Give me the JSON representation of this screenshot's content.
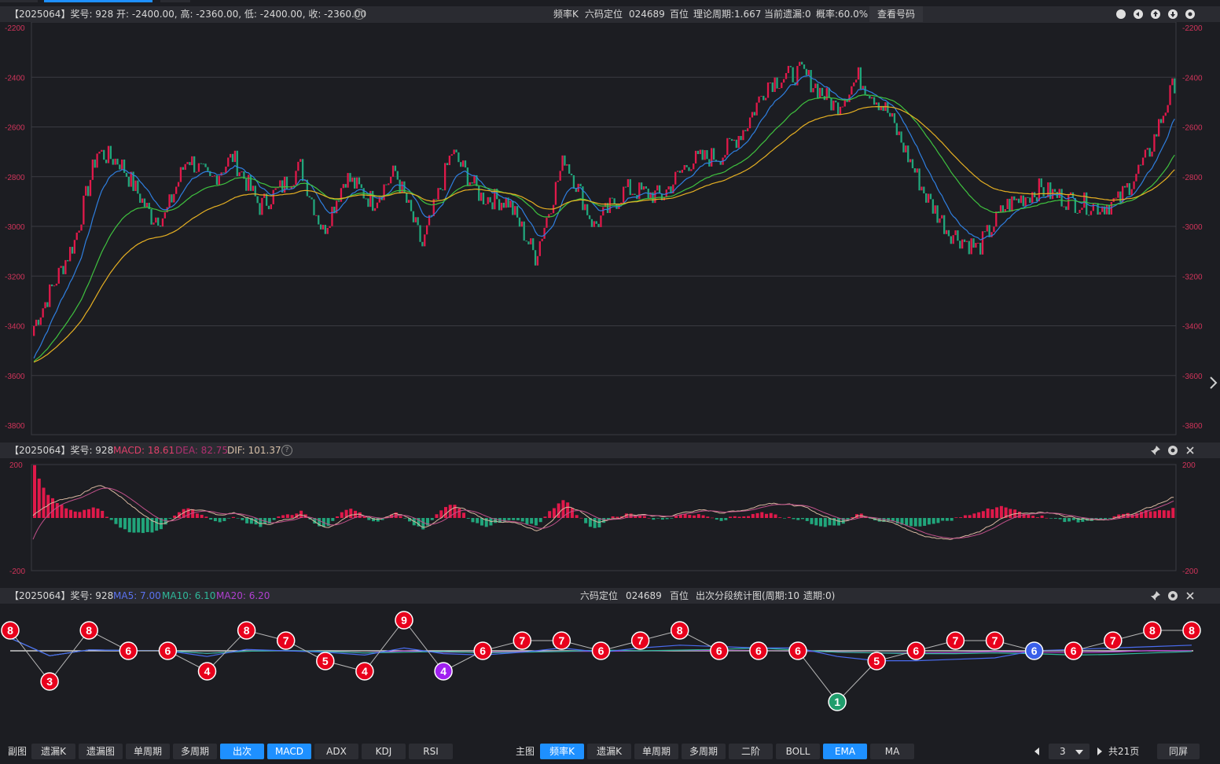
{
  "main_header": {
    "issue": "【2025064】奖号: 928",
    "ohlc": "开: -2400.00, 高: -2360.00, 低: -2400.00, 收: -2360.00",
    "mode": "频率K",
    "position_label": "六码定位",
    "codes": "024689",
    "digit": "百位",
    "theory_cycle": "理论周期:1.667",
    "current_miss": "当前遗漏:0",
    "probability": "概率:60.0%",
    "view_button": "查看号码"
  },
  "main_axis": {
    "ticks": [
      "-2200",
      "-2400",
      "-2600",
      "-2800",
      "-3000",
      "-3200",
      "-3400",
      "-3600",
      "-3800"
    ]
  },
  "macd_header": {
    "issue": "【2025064】奖号: 928",
    "macd_label": "MACD: 18.61",
    "dea_label": "DEA: 82.75",
    "dif_label": "DIF: 101.37"
  },
  "macd_axis": {
    "top": "200",
    "bottom": "-200"
  },
  "stat_header": {
    "issue": "【2025064】奖号: 928",
    "ma5_label": "MA5: 7.00",
    "ma10_label": "MA10: 6.10",
    "ma20_label": "MA20: 6.20",
    "position_label": "六码定位",
    "codes": "024689",
    "digit": "百位",
    "chart_title": "出次分段统计图(周期:10",
    "miss_note": "遗期:0)"
  },
  "stat_nodes": [
    {
      "v": "8",
      "c": "#e8001c"
    },
    {
      "v": "3",
      "c": "#e8001c"
    },
    {
      "v": "8",
      "c": "#e8001c"
    },
    {
      "v": "6",
      "c": "#e8001c"
    },
    {
      "v": "6",
      "c": "#e8001c"
    },
    {
      "v": "4",
      "c": "#e8001c"
    },
    {
      "v": "8",
      "c": "#e8001c"
    },
    {
      "v": "7",
      "c": "#e8001c"
    },
    {
      "v": "5",
      "c": "#e8001c"
    },
    {
      "v": "4",
      "c": "#e8001c"
    },
    {
      "v": "9",
      "c": "#e8001c"
    },
    {
      "v": "4",
      "c": "#a020f0"
    },
    {
      "v": "6",
      "c": "#e8001c"
    },
    {
      "v": "7",
      "c": "#e8001c"
    },
    {
      "v": "7",
      "c": "#e8001c"
    },
    {
      "v": "6",
      "c": "#e8001c"
    },
    {
      "v": "7",
      "c": "#e8001c"
    },
    {
      "v": "8",
      "c": "#e8001c"
    },
    {
      "v": "6",
      "c": "#e8001c"
    },
    {
      "v": "6",
      "c": "#e8001c"
    },
    {
      "v": "6",
      "c": "#e8001c"
    },
    {
      "v": "1",
      "c": "#1f9d6c"
    },
    {
      "v": "5",
      "c": "#e8001c"
    },
    {
      "v": "6",
      "c": "#e8001c"
    },
    {
      "v": "7",
      "c": "#e8001c"
    },
    {
      "v": "7",
      "c": "#e8001c"
    },
    {
      "v": "6",
      "c": "#3a5fe8"
    },
    {
      "v": "6",
      "c": "#e8001c"
    },
    {
      "v": "7",
      "c": "#e8001c"
    },
    {
      "v": "8",
      "c": "#e8001c"
    },
    {
      "v": "8",
      "c": "#e8001c"
    }
  ],
  "bottom_bar": {
    "sub_label": "副图",
    "sub_buttons": [
      "遗漏K",
      "遗漏图",
      "单周期",
      "多周期",
      "出次",
      "MACD",
      "ADX",
      "KDJ",
      "RSI"
    ],
    "sub_active": [
      4,
      5
    ],
    "main_label": "主图",
    "main_buttons": [
      "频率K",
      "遗漏K",
      "单周期",
      "多周期",
      "二阶",
      "BOLL",
      "EMA",
      "MA"
    ],
    "main_active": [
      0,
      6
    ],
    "page_value": "3",
    "total_pages": "共21页",
    "fullscreen": "同屏"
  },
  "colors": {
    "up": "#e0194a",
    "down": "#21a57b",
    "ema_fast": "#2f7fe0",
    "ema_mid": "#3fc23f",
    "ema_slow": "#e6b022",
    "macd_dif": "#d8b8a0",
    "macd_dea": "#c0508a",
    "ma5": "#4a6cf0",
    "ma10": "#2fb89a",
    "ma20": "#b040d0"
  }
}
